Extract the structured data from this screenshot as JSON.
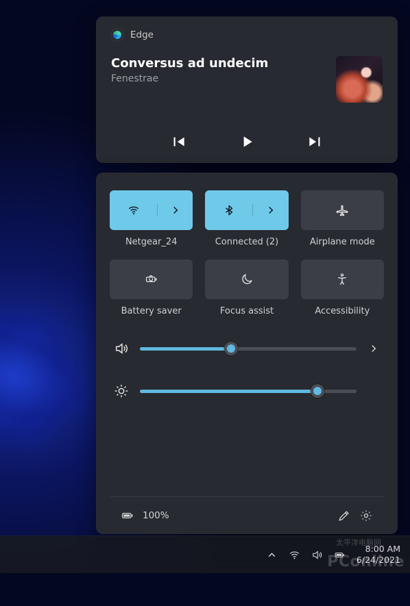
{
  "media": {
    "app_name": "Edge",
    "title": "Conversus ad undecim",
    "subtitle": "Fenestrae"
  },
  "quick_settings": {
    "tiles": [
      {
        "id": "wifi",
        "label": "Netgear_24",
        "active": true,
        "split": true,
        "icon": "wifi"
      },
      {
        "id": "bluetooth",
        "label": "Connected (2)",
        "active": true,
        "split": true,
        "icon": "bluetooth"
      },
      {
        "id": "airplane",
        "label": "Airplane mode",
        "active": false,
        "split": false,
        "icon": "airplane"
      },
      {
        "id": "battery-saver",
        "label": "Battery saver",
        "active": false,
        "split": false,
        "icon": "battery-saver"
      },
      {
        "id": "focus-assist",
        "label": "Focus assist",
        "active": false,
        "split": false,
        "icon": "moon"
      },
      {
        "id": "accessibility",
        "label": "Accessibility",
        "active": false,
        "split": false,
        "icon": "accessibility"
      }
    ],
    "volume_pct": 42,
    "brightness_pct": 82,
    "battery_label": "100%"
  },
  "taskbar": {
    "time": "8:00 AM",
    "date": "6/24/2021"
  },
  "watermark": {
    "main": "PConline",
    "sub": "太平洋电脑网"
  }
}
